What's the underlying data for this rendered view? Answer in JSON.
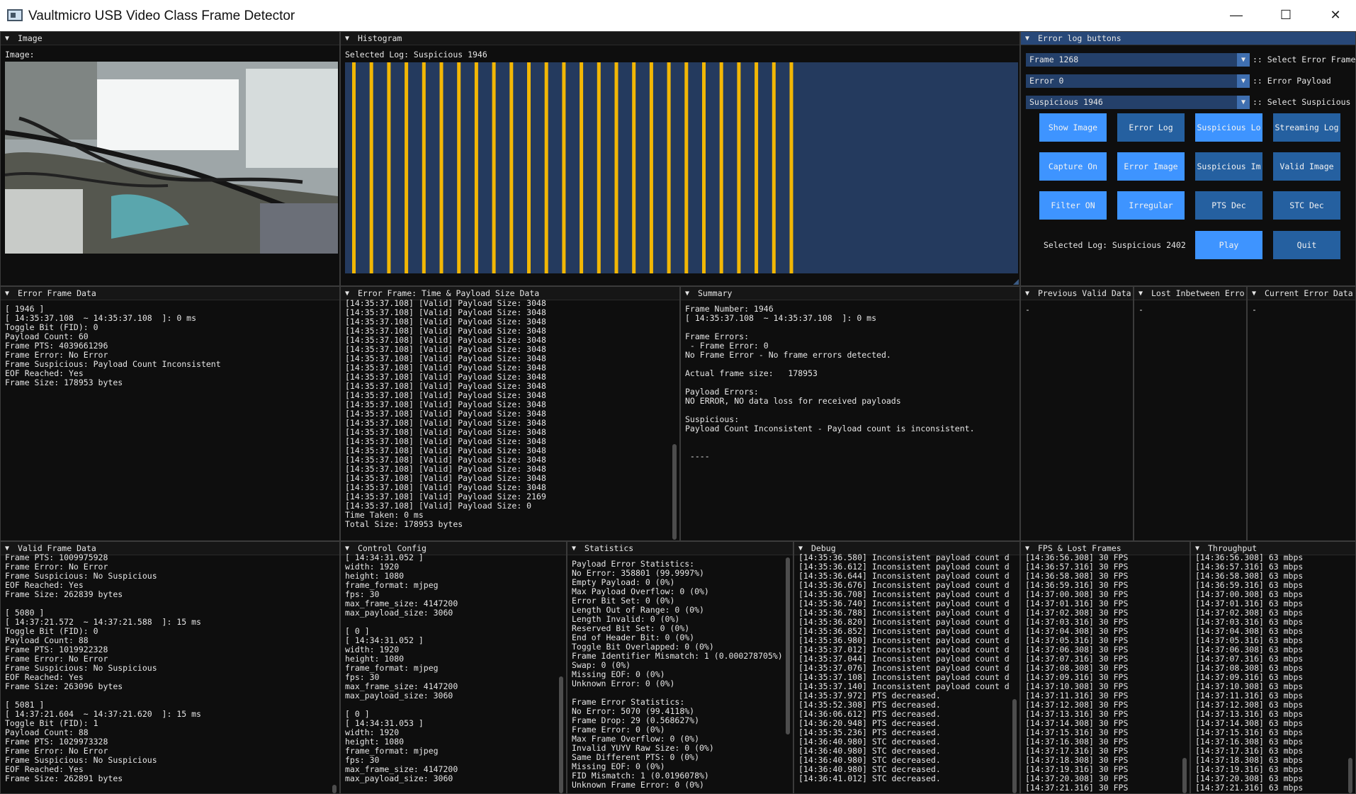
{
  "window": {
    "title": "Vaultmicro USB Video Class Frame Detector",
    "minimize": "—",
    "maximize": "☐",
    "close": "✕"
  },
  "image_pane": {
    "title": "Image",
    "label": "Image:"
  },
  "histogram": {
    "title": "Histogram",
    "selected": "Selected Log: Suspicious 1946",
    "bar_color": "#f2b705",
    "bars_count": 26
  },
  "errlog": {
    "title": "Error log buttons",
    "combos": [
      {
        "value": "Frame 1268",
        "label": ":: Select Error Frame"
      },
      {
        "value": "Error 0",
        "label": ":: Error Payload"
      },
      {
        "value": "Suspicious 1946",
        "label": ":: Select Suspicious"
      }
    ],
    "buttons": [
      {
        "label": "Show Image",
        "on": true
      },
      {
        "label": "Error Log",
        "on": false
      },
      {
        "label": "Suspicious Lo",
        "on": true
      },
      {
        "label": "Streaming Log",
        "on": false
      },
      {
        "label": "Capture On",
        "on": true
      },
      {
        "label": "Error Image",
        "on": true
      },
      {
        "label": "Suspicious Im",
        "on": false
      },
      {
        "label": "Valid Image",
        "on": false
      },
      {
        "label": "Filter ON",
        "on": true
      },
      {
        "label": "Irregular",
        "on": true
      },
      {
        "label": "PTS Dec",
        "on": false
      },
      {
        "label": "STC Dec",
        "on": false
      }
    ],
    "selected": "Selected Log: Suspicious 2402",
    "play": "Play",
    "quit": "Quit",
    "accent": "#3e94ff",
    "button_bg": "#2560a0"
  },
  "error_frame": {
    "title": "Error Frame Data",
    "lines": [
      "[ 1946 ]",
      "[ 14:35:37.108  ~ 14:35:37.108  ]: 0 ms",
      "Toggle Bit (FID): 0",
      "Payload Count: 60",
      "Frame PTS: 4039661296",
      "Frame Error: No Error",
      "Frame Suspicious: Payload Count Inconsistent",
      "EOF Reached: Yes",
      "Frame Size: 178953 bytes"
    ]
  },
  "time_payload": {
    "title": "Error Frame: Time & Payload Size Data",
    "lines": [
      "[14:35:37.108] [Valid] Payload Size: 3048",
      "[14:35:37.108] [Valid] Payload Size: 3048",
      "[14:35:37.108] [Valid] Payload Size: 3048",
      "[14:35:37.108] [Valid] Payload Size: 3048",
      "[14:35:37.108] [Valid] Payload Size: 3048",
      "[14:35:37.108] [Valid] Payload Size: 3048",
      "[14:35:37.108] [Valid] Payload Size: 3048",
      "[14:35:37.108] [Valid] Payload Size: 3048",
      "[14:35:37.108] [Valid] Payload Size: 3048",
      "[14:35:37.108] [Valid] Payload Size: 3048",
      "[14:35:37.108] [Valid] Payload Size: 3048",
      "[14:35:37.108] [Valid] Payload Size: 3048",
      "[14:35:37.108] [Valid] Payload Size: 3048",
      "[14:35:37.108] [Valid] Payload Size: 3048",
      "[14:35:37.108] [Valid] Payload Size: 3048",
      "[14:35:37.108] [Valid] Payload Size: 3048",
      "[14:35:37.108] [Valid] Payload Size: 3048",
      "[14:35:37.108] [Valid] Payload Size: 3048",
      "[14:35:37.108] [Valid] Payload Size: 3048",
      "[14:35:37.108] [Valid] Payload Size: 3048",
      "[14:35:37.108] [Valid] Payload Size: 3048",
      "[14:35:37.108] [Valid] Payload Size: 2169",
      "[14:35:37.108] [Valid] Payload Size: 0",
      "Time Taken: 0 ms",
      "Total Size: 178953 bytes"
    ]
  },
  "summary": {
    "title": "Summary",
    "lines": [
      "Frame Number: 1946",
      "[ 14:35:37.108  ~ 14:35:37.108  ]: 0 ms",
      "",
      "Frame Errors:",
      " - Frame Error: 0",
      "No Frame Error - No frame errors detected.",
      "",
      "Actual frame size:   178953",
      "",
      "Payload Errors:",
      "NO ERROR, NO data loss for received payloads",
      "",
      "Suspicious:",
      "Payload Count Inconsistent - Payload count is inconsistent.",
      "",
      "",
      " ----"
    ]
  },
  "prev_valid": {
    "title": "Previous Valid Data",
    "text": "-"
  },
  "lost_between": {
    "title": "Lost Inbetween Erro",
    "text": "-"
  },
  "current_error": {
    "title": "Current Error Data",
    "text": "-"
  },
  "valid_frame": {
    "title": "Valid Frame Data",
    "lines": [
      "Frame PTS: 1009975928",
      "Frame Error: No Error",
      "Frame Suspicious: No Suspicious",
      "EOF Reached: Yes",
      "Frame Size: 262839 bytes",
      "",
      "[ 5080 ]",
      "[ 14:37:21.572  ~ 14:37:21.588  ]: 15 ms",
      "Toggle Bit (FID): 0",
      "Payload Count: 88",
      "Frame PTS: 1019922328",
      "Frame Error: No Error",
      "Frame Suspicious: No Suspicious",
      "EOF Reached: Yes",
      "Frame Size: 263096 bytes",
      "",
      "[ 5081 ]",
      "[ 14:37:21.604  ~ 14:37:21.620  ]: 15 ms",
      "Toggle Bit (FID): 1",
      "Payload Count: 88",
      "Frame PTS: 1029973328",
      "Frame Error: No Error",
      "Frame Suspicious: No Suspicious",
      "EOF Reached: Yes",
      "Frame Size: 262891 bytes"
    ]
  },
  "control_config": {
    "title": "Control Config",
    "lines": [
      "[ 14:34:31.052 ]",
      "width: 1920",
      "height: 1080",
      "frame_format: mjpeg",
      "fps: 30",
      "max_frame_size: 4147200",
      "max_payload_size: 3060",
      "",
      "[ 0 ]",
      "[ 14:34:31.052 ]",
      "width: 1920",
      "height: 1080",
      "frame_format: mjpeg",
      "fps: 30",
      "max_frame_size: 4147200",
      "max_payload_size: 3060",
      "",
      "[ 0 ]",
      "[ 14:34:31.053 ]",
      "width: 1920",
      "height: 1080",
      "frame_format: mjpeg",
      "fps: 30",
      "max_frame_size: 4147200",
      "max_payload_size: 3060"
    ]
  },
  "statistics": {
    "title": "Statistics",
    "lines": [
      "Payload Error Statistics:",
      "No Error: 358801 (99.9997%)",
      "Empty Payload: 0 (0%)",
      "Max Payload Overflow: 0 (0%)",
      "Error Bit Set: 0 (0%)",
      "Length Out of Range: 0 (0%)",
      "Length Invalid: 0 (0%)",
      "Reserved Bit Set: 0 (0%)",
      "End of Header Bit: 0 (0%)",
      "Toggle Bit Overlapped: 0 (0%)",
      "Frame Identifier Mismatch: 1 (0.000278705%)",
      "Swap: 0 (0%)",
      "Missing EOF: 0 (0%)",
      "Unknown Error: 0 (0%)",
      "",
      "Frame Error Statistics:",
      "No Error: 5070 (99.4118%)",
      "Frame Drop: 29 (0.568627%)",
      "Frame Error: 0 (0%)",
      "Max Frame Overflow: 0 (0%)",
      "Invalid YUYV Raw Size: 0 (0%)",
      "Same Different PTS: 0 (0%)",
      "Missing EOF: 0 (0%)",
      "FID Mismatch: 1 (0.0196078%)",
      "Unknown Frame Error: 0 (0%)"
    ]
  },
  "debug": {
    "title": "Debug",
    "lines": [
      "[14:35:36.580] Inconsistent payload count d",
      "[14:35:36.612] Inconsistent payload count d",
      "[14:35:36.644] Inconsistent payload count d",
      "[14:35:36.676] Inconsistent payload count d",
      "[14:35:36.708] Inconsistent payload count d",
      "[14:35:36.740] Inconsistent payload count d",
      "[14:35:36.788] Inconsistent payload count d",
      "[14:35:36.820] Inconsistent payload count d",
      "[14:35:36.852] Inconsistent payload count d",
      "[14:35:36.980] Inconsistent payload count d",
      "[14:35:37.012] Inconsistent payload count d",
      "[14:35:37.044] Inconsistent payload count d",
      "[14:35:37.076] Inconsistent payload count d",
      "[14:35:37.108] Inconsistent payload count d",
      "[14:35:37.140] Inconsistent payload count d",
      "[14:35:37.972] PTS decreased.",
      "[14:35:52.308] PTS decreased.",
      "[14:36:06.612] PTS decreased.",
      "[14:36:20.948] PTS decreased.",
      "[14:35:35.236] PTS decreased.",
      "[14:36:40.980] STC decreased.",
      "[14:36:40.980] STC decreased.",
      "[14:36:40.980] STC decreased.",
      "[14:36:40.980] STC decreased.",
      "[14:36:41.012] STC decreased."
    ]
  },
  "fps": {
    "title": "FPS & Lost Frames",
    "lines": [
      "[14:36:56.308] 30 FPS",
      "[14:36:57.316] 30 FPS",
      "[14:36:58.308] 30 FPS",
      "[14:36:59.316] 30 FPS",
      "[14:37:00.308] 30 FPS",
      "[14:37:01.316] 30 FPS",
      "[14:37:02.308] 30 FPS",
      "[14:37:03.316] 30 FPS",
      "[14:37:04.308] 30 FPS",
      "[14:37:05.316] 30 FPS",
      "[14:37:06.308] 30 FPS",
      "[14:37:07.316] 30 FPS",
      "[14:37:08.308] 30 FPS",
      "[14:37:09.316] 30 FPS",
      "[14:37:10.308] 30 FPS",
      "[14:37:11.316] 30 FPS",
      "[14:37:12.308] 30 FPS",
      "[14:37:13.316] 30 FPS",
      "[14:37:14.308] 30 FPS",
      "[14:37:15.316] 30 FPS",
      "[14:37:16.308] 30 FPS",
      "[14:37:17.316] 30 FPS",
      "[14:37:18.308] 30 FPS",
      "[14:37:19.316] 30 FPS",
      "[14:37:20.308] 30 FPS",
      "[14:37:21.316] 30 FPS"
    ]
  },
  "throughput": {
    "title": "Throughput",
    "lines": [
      "[14:36:56.308] 63 mbps",
      "[14:36:57.316] 63 mbps",
      "[14:36:58.308] 63 mbps",
      "[14:36:59.316] 63 mbps",
      "[14:37:00.308] 63 mbps",
      "[14:37:01.316] 63 mbps",
      "[14:37:02.308] 63 mbps",
      "[14:37:03.316] 63 mbps",
      "[14:37:04.308] 63 mbps",
      "[14:37:05.316] 63 mbps",
      "[14:37:06.308] 63 mbps",
      "[14:37:07.316] 63 mbps",
      "[14:37:08.308] 63 mbps",
      "[14:37:09.316] 63 mbps",
      "[14:37:10.308] 63 mbps",
      "[14:37:11.316] 63 mbps",
      "[14:37:12.308] 63 mbps",
      "[14:37:13.316] 63 mbps",
      "[14:37:14.308] 63 mbps",
      "[14:37:15.316] 63 mbps",
      "[14:37:16.308] 63 mbps",
      "[14:37:17.316] 63 mbps",
      "[14:37:18.308] 63 mbps",
      "[14:37:19.316] 63 mbps",
      "[14:37:20.308] 63 mbps",
      "[14:37:21.316] 63 mbps"
    ]
  }
}
